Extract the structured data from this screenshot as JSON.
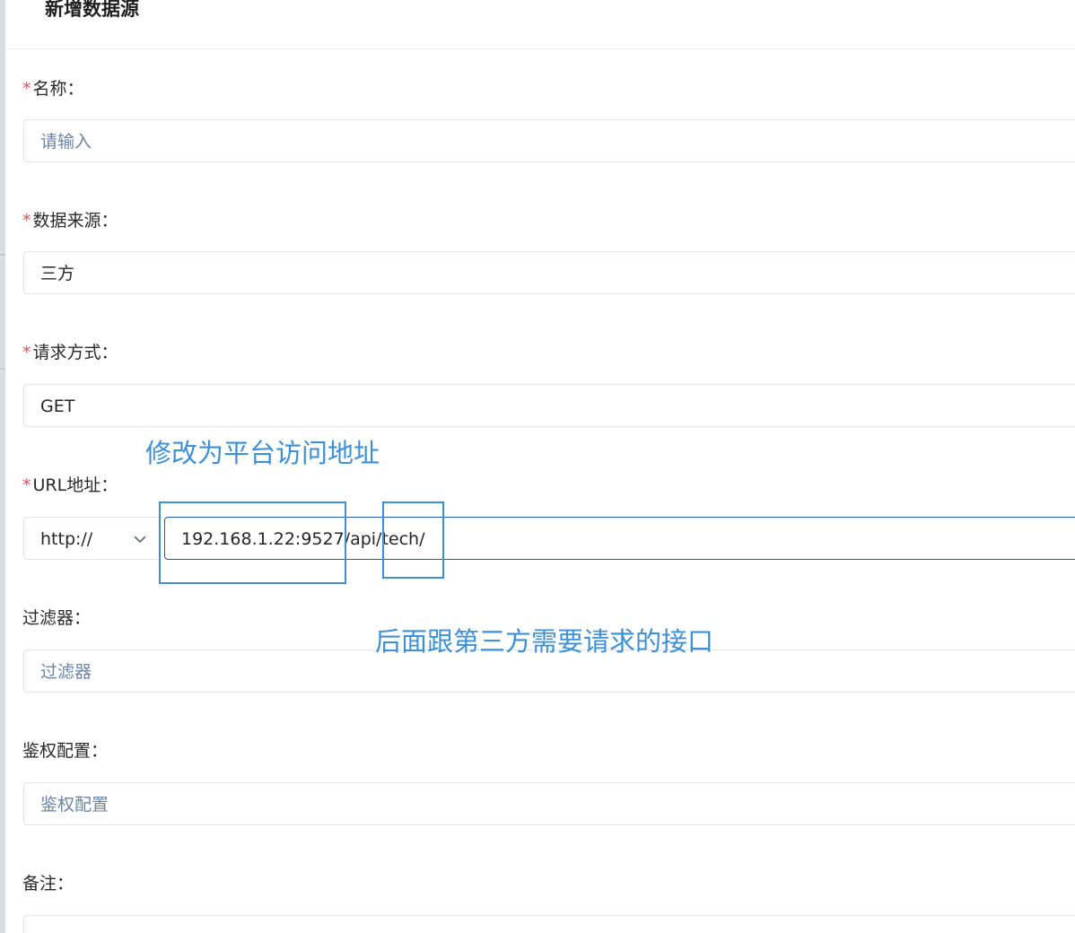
{
  "dialog": {
    "title": "新增数据源"
  },
  "form": {
    "name": {
      "required_mark": "*",
      "label": "名称：",
      "placeholder": "请输入"
    },
    "source": {
      "required_mark": "*",
      "label": "数据来源：",
      "value": "三方"
    },
    "method": {
      "required_mark": "*",
      "label": "请求方式：",
      "value": "GET"
    },
    "url": {
      "required_mark": "*",
      "label": "URL地址：",
      "protocol": "http://",
      "value": "192.168.1.22:9527/api/tech/"
    },
    "filter": {
      "label": "过滤器：",
      "placeholder": "过滤器"
    },
    "auth": {
      "label": "鉴权配置：",
      "placeholder": "鉴权配置"
    },
    "remark": {
      "label": "备注："
    }
  },
  "annotations": {
    "modify_note": "修改为平台访问地址",
    "suffix_note": "后面跟第三方需要请求的接口",
    "color": "#3d8fd6"
  },
  "icons": {
    "protocol_dropdown": "chevron-down-icon"
  },
  "colors": {
    "required": "#e34d59",
    "input_focus_border": "#1f58b7",
    "placeholder": "#6b84a8"
  }
}
